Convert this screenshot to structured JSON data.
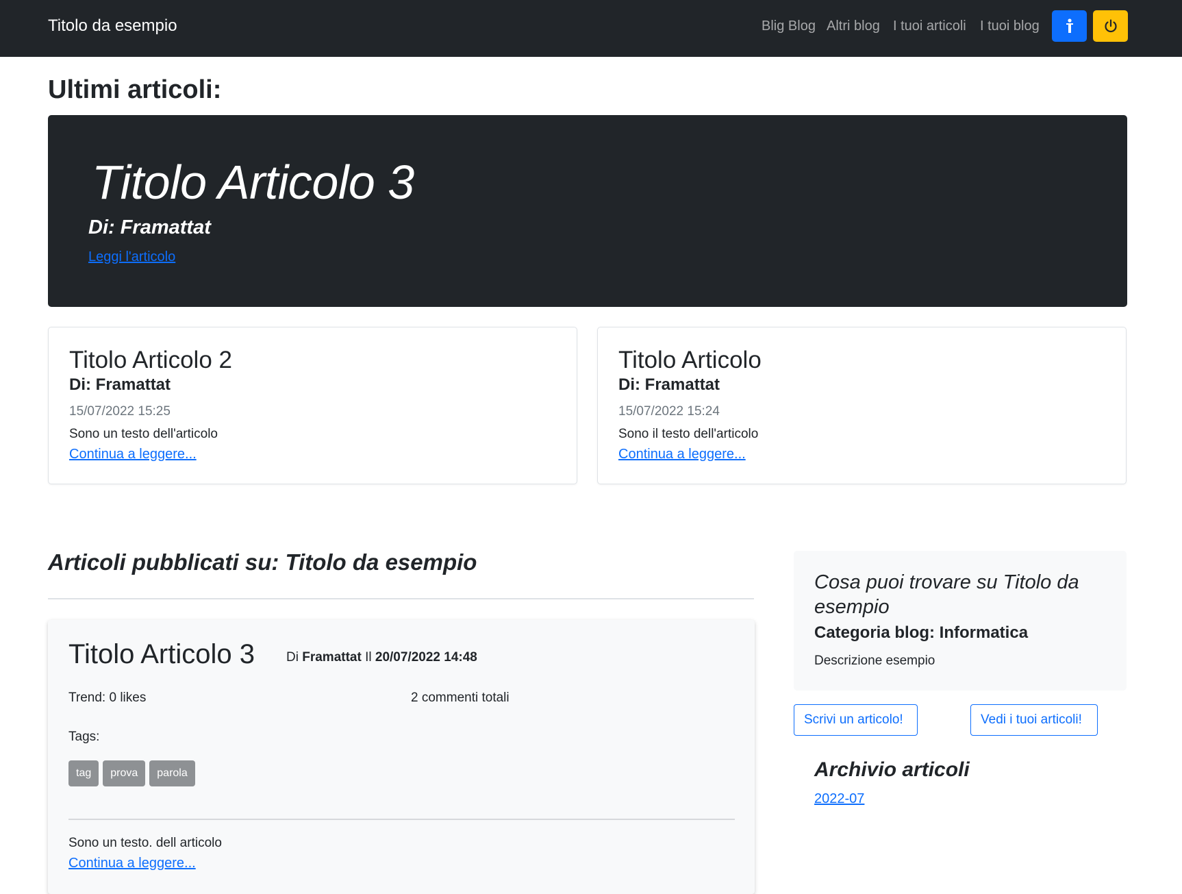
{
  "navbar": {
    "brand": "Titolo da esempio",
    "links": [
      "Blig Blog",
      "Altri blog",
      "I tuoi articoli",
      "I tuoi blog"
    ],
    "buttons": [
      {
        "icon": "person-icon",
        "color": "#0d6efd"
      },
      {
        "icon": "power-icon",
        "color": "#ffc107"
      }
    ]
  },
  "latest": {
    "heading": "Ultimi articoli:",
    "hero": {
      "title": "Titolo Articolo 3",
      "author": "Di: Framattat",
      "link": "Leggi l'articolo"
    },
    "cards": [
      {
        "title": "Titolo Articolo 2",
        "author": "Di: Framattat",
        "date": "15/07/2022 15:25",
        "text": "Sono un testo dell'articolo",
        "link": "Continua a leggere..."
      },
      {
        "title": "Titolo Articolo",
        "author": "Di: Framattat",
        "date": "15/07/2022 15:24",
        "text": "Sono il testo dell'articolo",
        "link": "Continua a leggere..."
      }
    ]
  },
  "posts": {
    "heading": "Articoli pubblicati su: Titolo da esempio",
    "items": [
      {
        "title": "Titolo Articolo 3",
        "meta_prefix": "Di",
        "author": "Framattat",
        "meta_sep": "Il",
        "date": "20/07/2022 14:48",
        "trend": "Trend: 0 likes",
        "comments": "2 commenti totali",
        "tags_label": "Tags:",
        "tags": [
          "tag",
          "prova",
          "parola"
        ],
        "text": "Sono un testo. dell articolo",
        "link": "Continua a leggere..."
      }
    ]
  },
  "sidebar": {
    "title": "Cosa puoi trovare su Titolo da esempio",
    "category": "Categoria blog: Informatica",
    "description": "Descrizione esempio",
    "write_button": "Scrivi un articolo!",
    "see_button": "Vedi i tuoi articoli!",
    "archive_title": "Archivio articoli",
    "archive_links": [
      "2022-07"
    ]
  },
  "colors": {
    "dark": "#212529",
    "primary": "#0d6efd",
    "warning": "#ffc107",
    "light": "#f8f9fa",
    "tag_bg": "#8e9194"
  }
}
